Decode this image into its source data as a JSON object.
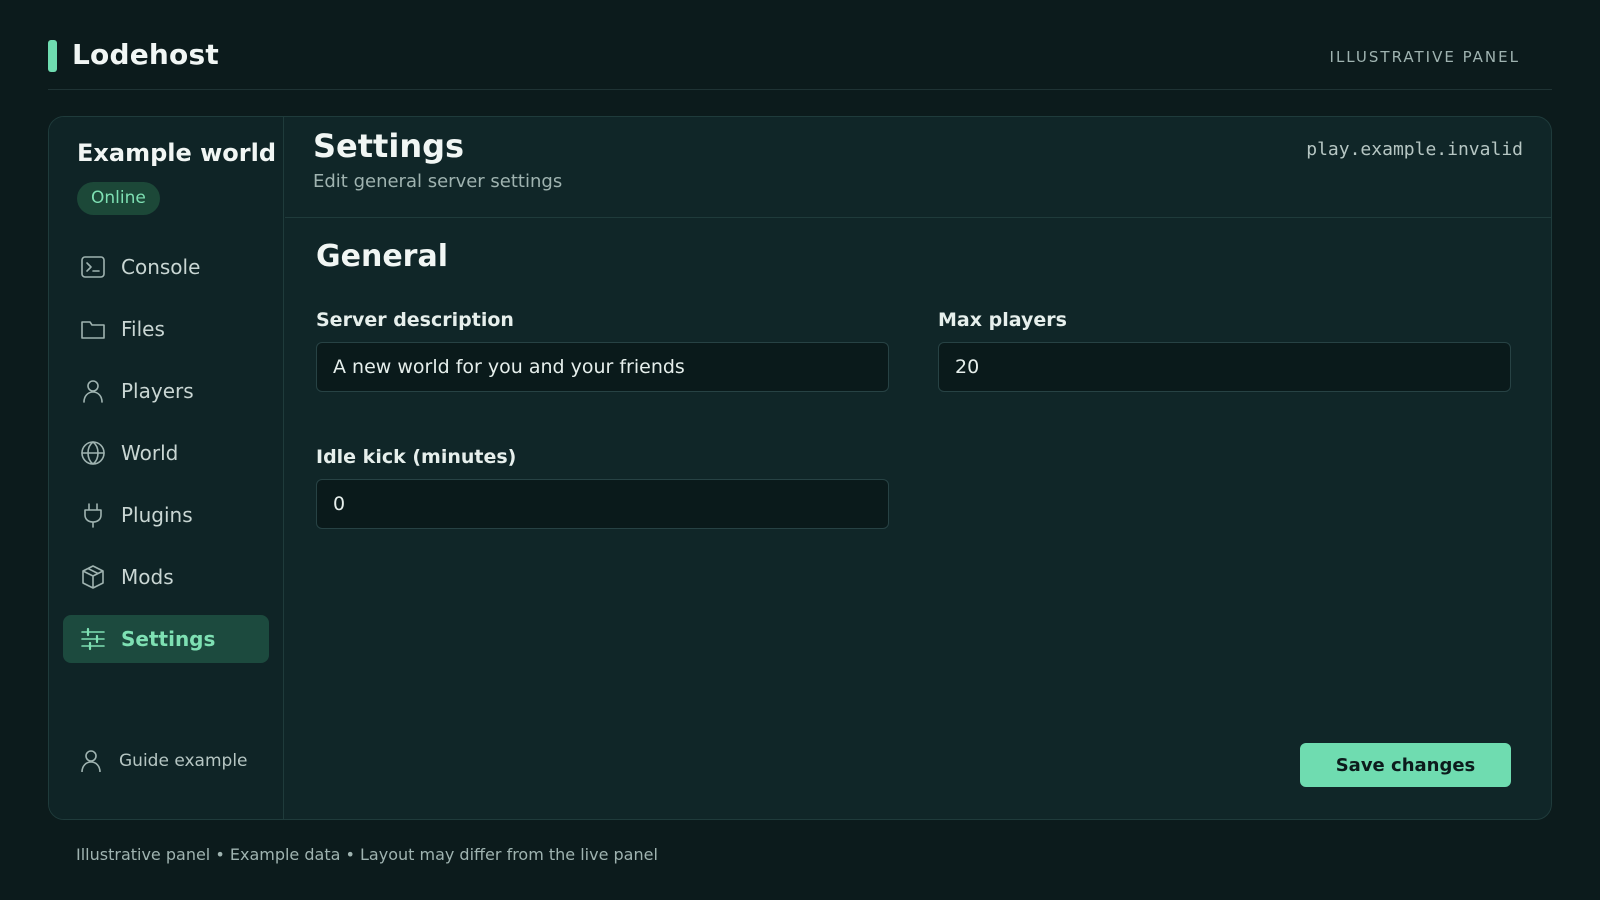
{
  "app": {
    "brand": "Lodehost",
    "tag": "ILLUSTRATIVE PANEL",
    "accent_color": "#6fdcb0"
  },
  "sidebar": {
    "world_name": "Example world",
    "status": "Online",
    "items": [
      {
        "label": "Console",
        "icon": "terminal-icon"
      },
      {
        "label": "Files",
        "icon": "folder-icon"
      },
      {
        "label": "Players",
        "icon": "user-icon"
      },
      {
        "label": "World",
        "icon": "globe-icon"
      },
      {
        "label": "Plugins",
        "icon": "plug-icon"
      },
      {
        "label": "Mods",
        "icon": "box-icon"
      },
      {
        "label": "Settings",
        "icon": "sliders-icon",
        "active": true
      }
    ],
    "user": "Guide example"
  },
  "header": {
    "title": "Settings",
    "subtitle": "Edit general server settings",
    "host": "play.example.invalid"
  },
  "form": {
    "section_title": "General",
    "server_description": {
      "label": "Server description",
      "value": "A new world for you and your friends"
    },
    "max_players": {
      "label": "Max players",
      "value": "20"
    },
    "idle_kick": {
      "label": "Idle kick (minutes)",
      "value": "0"
    },
    "save_label": "Save changes"
  },
  "footer": {
    "text": "Illustrative panel • Example data • Layout may differ from the live panel"
  }
}
